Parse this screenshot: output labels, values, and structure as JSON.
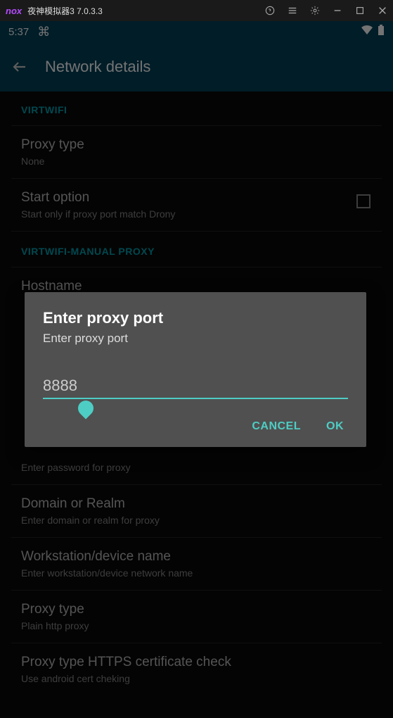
{
  "titlebar": {
    "logo": "nox",
    "text": "夜神模拟器3 7.0.3.3"
  },
  "statusbar": {
    "time": "5:37"
  },
  "header": {
    "title": "Network details"
  },
  "sections": {
    "s1_label": "VIRTWIFI",
    "proxy_type": {
      "title": "Proxy type",
      "sub": "None"
    },
    "start_option": {
      "title": "Start option",
      "sub": "Start only if proxy port match Drony"
    },
    "s2_label": "VIRTWIFI-MANUAL PROXY",
    "hostname": {
      "title": "Hostname"
    },
    "password_sub": "Enter password for proxy",
    "domain": {
      "title": "Domain or Realm",
      "sub": "Enter domain or realm for proxy"
    },
    "workstation": {
      "title": "Workstation/device name",
      "sub": "Enter workstation/device network name"
    },
    "proxy_type2": {
      "title": "Proxy type",
      "sub": "Plain http proxy"
    },
    "cert": {
      "title": "Proxy type HTTPS certificate check",
      "sub": "Use android cert cheking"
    }
  },
  "dialog": {
    "title": "Enter proxy port",
    "sub": "Enter proxy port",
    "value": "8888",
    "cancel": "CANCEL",
    "ok": "OK"
  }
}
